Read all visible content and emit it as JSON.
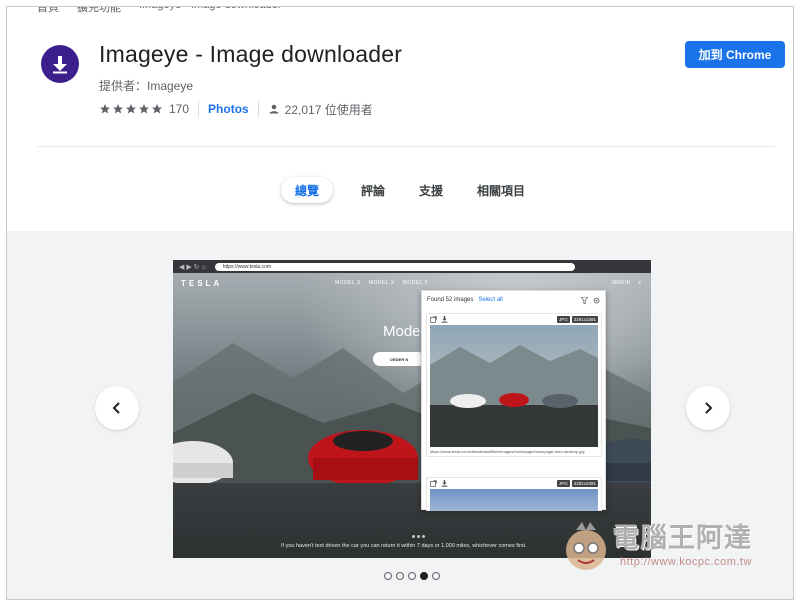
{
  "breadcrumbs": [
    "首頁",
    "擴充功能",
    "Imageye - Image downloader"
  ],
  "extension": {
    "title": "Imageye - Image downloader",
    "provider": "提供者：Imageye",
    "rating_count": "170",
    "rating_stars": 5,
    "category": "Photos",
    "users": "22,017 位使用者"
  },
  "add_button": "加到 Chrome",
  "tabs": [
    {
      "label": "總覽",
      "active": true
    },
    {
      "label": "評論",
      "active": false
    },
    {
      "label": "支援",
      "active": false
    },
    {
      "label": "相關項目",
      "active": false
    }
  ],
  "screenshot": {
    "url": "https://www.tesla.com",
    "tesla_logo": "TESLA",
    "tesla_nav": [
      "MODEL S",
      "MODEL X",
      "MODEL 3"
    ],
    "tesla_right": [
      "SIGN IN",
      "≡"
    ],
    "hero_title": "Mode",
    "order_button": "ORDER N",
    "caption": "If you haven't test driven the car you can return it within 7 days or 1,000 miles, whichever comes first.",
    "popup": {
      "found": "Found 52 images",
      "select_all": "Select all",
      "badge_type": "JPG",
      "badge_size": "3281x2391",
      "image_url": "https://www.tesla.com/sites/default/files/images/homepage/homepage-hero-desktop.jpg"
    }
  },
  "pager": {
    "count": 5,
    "active_index": 3
  },
  "watermark": {
    "text": "電腦王阿達",
    "url": "http://www.kocpc.com.tw"
  },
  "colors": {
    "accent": "#1a73e8",
    "logo_bg": "#3c1e8c"
  }
}
